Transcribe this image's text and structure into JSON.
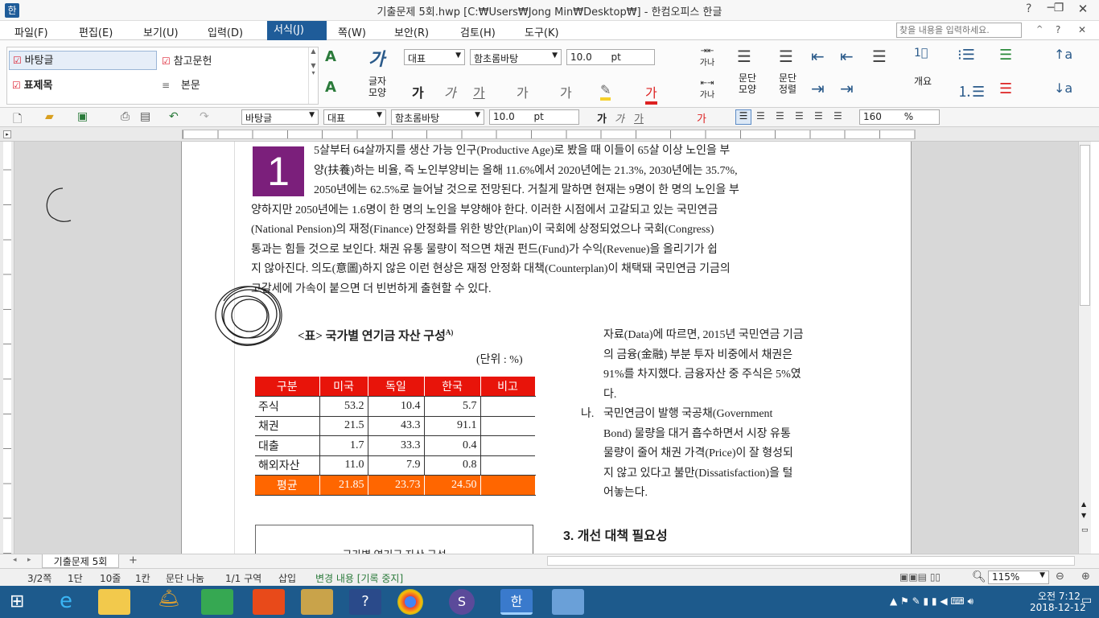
{
  "window": {
    "title": "기출문제 5회.hwp [C:₩Users₩Jong Min₩Desktop₩] - 한컴오피스 한글"
  },
  "menu": {
    "items": [
      "파일(F)",
      "편집(E)",
      "보기(U)",
      "입력(D)",
      "서식(J)",
      "쪽(W)",
      "보안(R)",
      "검토(H)",
      "도구(K)"
    ],
    "active": "서식(J)",
    "search_placeholder": "찾을 내용을 입력하세요."
  },
  "styles_panel": {
    "items": [
      "바탕글",
      "참고문헌",
      "표제목",
      "본문"
    ]
  },
  "ribbon": {
    "font_lang": "대표",
    "font_name": "함초롬바탕",
    "font_size": "10.0",
    "font_unit": "pt",
    "char_shape_label": "글자 모양",
    "para_shape_label": "문단 모양",
    "para_align_label": "문단 정렬",
    "outline_label": "개요",
    "ga_label": "가나",
    "ga2_label": "가나"
  },
  "toolbar2": {
    "style": "바탕글",
    "font_lang": "대표",
    "font_name": "함초롬바탕",
    "font_size": "10.0",
    "font_unit": "pt",
    "line_spacing": "160",
    "line_spacing_unit": "%"
  },
  "document": {
    "dropcap": "1",
    "para1_lines": [
      "5살부터 64살까지를 생산 가능 인구(Productive Age)로 봤을 때 이들이 65살 이상 노인을 부",
      "양(扶養)하는 비율, 즉 노인부양비는 올해 11.6%에서 2020년에는 21.3%, 2030년에는 35.7%,",
      "2050년에는 62.5%로 늘어날 것으로 전망된다. 거칠게 말하면 현재는 9명이 한 명의 노인을 부",
      "양하지만 2050년에는 1.6명이 한 명의 노인을 부양해야 한다. 이러한 시점에서 고갈되고 있는 국민연금",
      "(National Pension)의 재정(Finance) 안정화를 위한 방안(Plan)이 국회에 상정되었으나 국회(Congress)",
      "통과는 힘들 것으로 보인다. 채권 유통 물량이 적으면 채권 펀드(Fund)가 수익(Revenue)을 올리기가 쉽",
      "지 않아진다. 의도(意圖)하지 않은 이런 현상은 재정 안정화 대책(Counterplan)이 채택돼 국민연금 기금의",
      "고갈세에 가속이 붙으면 더 빈번하게 출현할 수 있다."
    ],
    "table_title": "<표> 국가별 연기금 자산 구성",
    "table_footnote": "A)",
    "table_unit": "(단위 : %)",
    "table_headers": [
      "구분",
      "미국",
      "독일",
      "한국",
      "비고"
    ],
    "table_rows": [
      [
        "주식",
        "53.2",
        "10.4",
        "5.7",
        ""
      ],
      [
        "채권",
        "21.5",
        "43.3",
        "91.1",
        ""
      ],
      [
        "대출",
        "1.7",
        "33.3",
        "0.4",
        ""
      ],
      [
        "해외자산",
        "11.0",
        "7.9",
        "0.8",
        ""
      ]
    ],
    "table_footer": [
      "평균",
      "21.85",
      "23.73",
      "24.50",
      ""
    ],
    "right_col_lines": [
      "자료(Data)에 따르면, 2015년 국민연금 기금",
      "의 금융(金融) 부분 투자 비중에서 채권은",
      "91%를 차지했다. 금융자산 중 주식은 5%였",
      "다."
    ],
    "item_na_marker": "나.",
    "item_na_lines": [
      "국민연금이 발행 국공채(Government",
      "Bond) 물량을 대거 흡수하면서 시장 유통",
      "물량이 줄어 채권 가격(Price)이 잘 형성되",
      "지 않고 있다고 불만(Dissatisfaction)을 털",
      "어놓는다."
    ],
    "section3_heading": "3. 개선 대책 필요성",
    "chart_box_title": "국가별 연기금 자산 구성"
  },
  "doc_tab": {
    "name": "기출문제 5회"
  },
  "status": {
    "page": "3/2쪽",
    "column": "1단",
    "line": "10줄",
    "col": "1칸",
    "section_break": "문단 나눔",
    "section": "1/1 구역",
    "insert_mode": "삽입",
    "track_changes": "변경 내용 [기록 중지]",
    "zoom": "115%"
  },
  "taskbar": {
    "time": "오전 7:12",
    "date": "2018-12-12"
  }
}
